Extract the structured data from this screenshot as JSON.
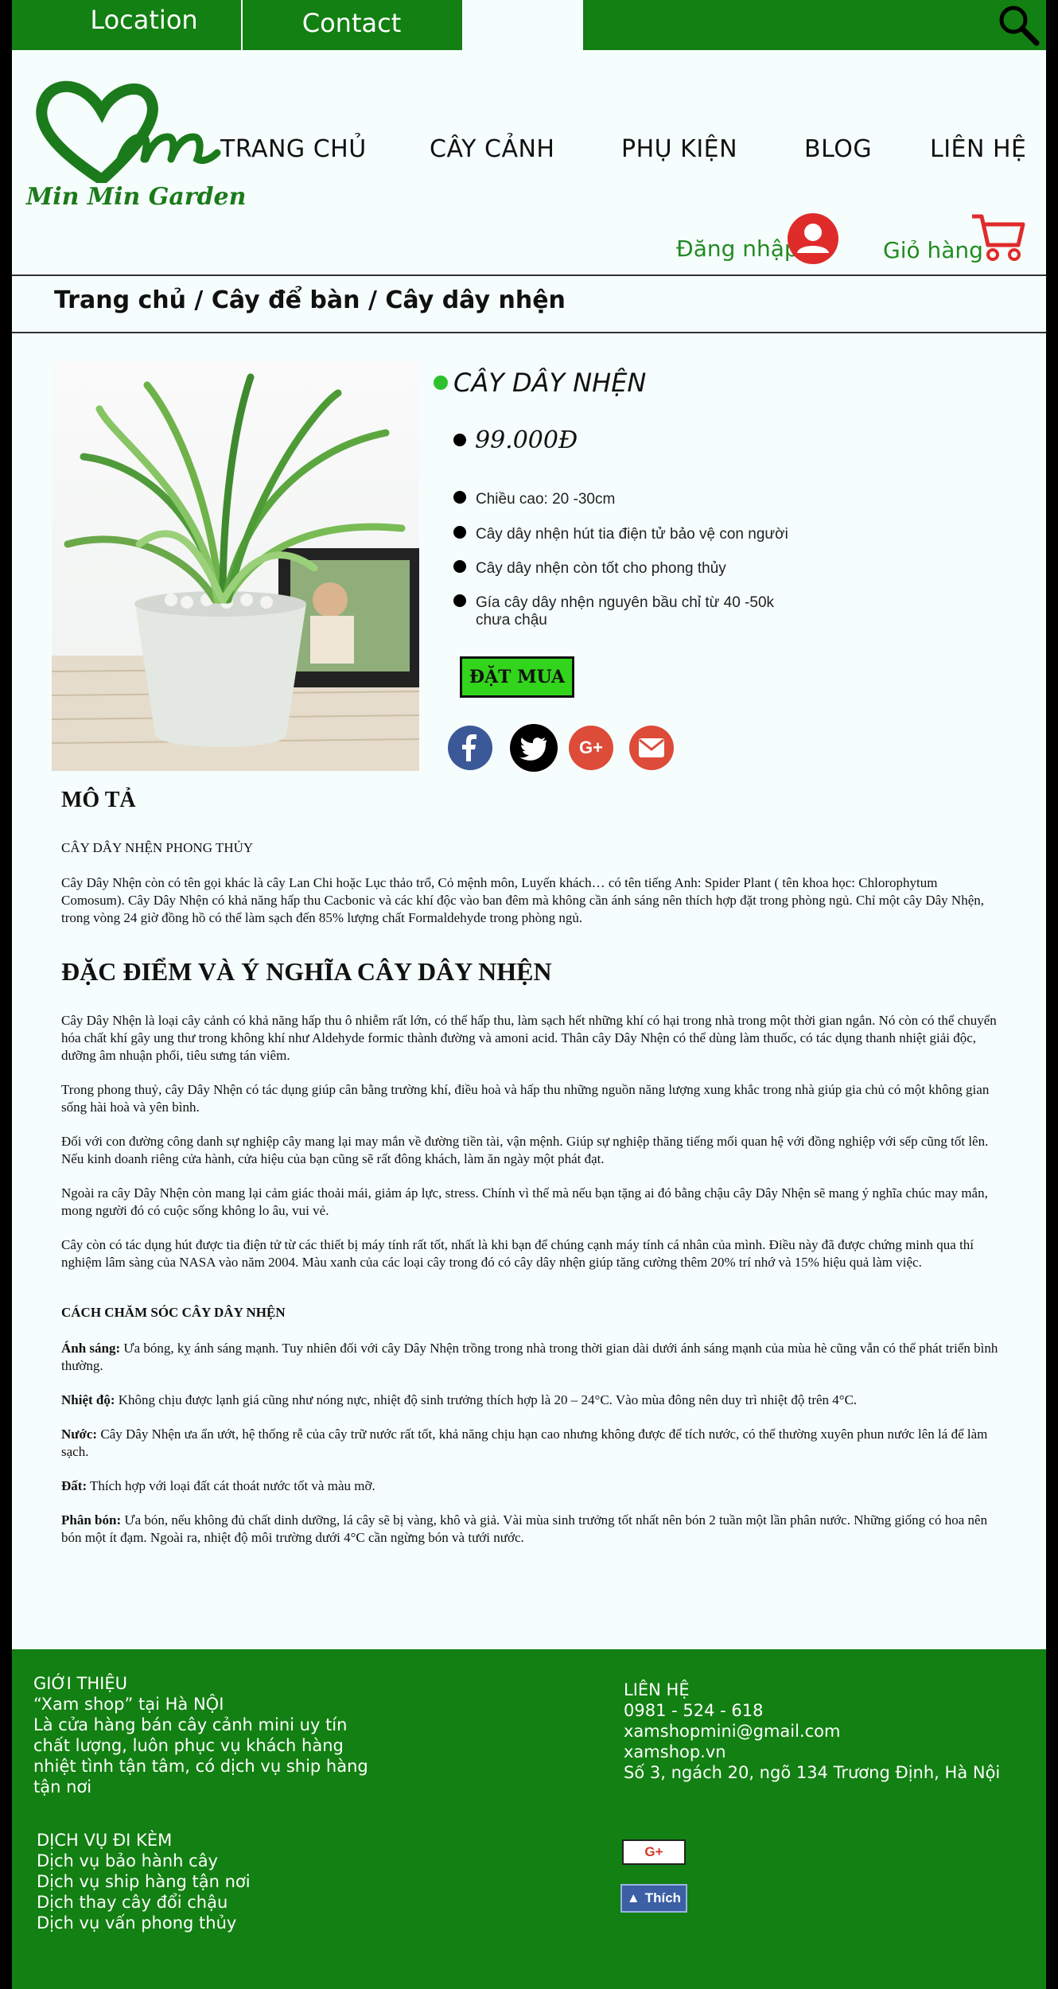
{
  "topbar": {
    "location_label": "Location",
    "contact_label": "Contact",
    "search_icon": "search-icon"
  },
  "logo": {
    "text": "Min Min Garden",
    "brand_color": "#1b7a1b"
  },
  "nav": {
    "items": [
      {
        "label": "TRANG CHỦ"
      },
      {
        "label": "CÂY CẢNH"
      },
      {
        "label": "PHỤ KIỆN"
      },
      {
        "label": "BLOG"
      },
      {
        "label": "LIÊN HỆ"
      }
    ],
    "login_label": "Đăng nhập",
    "cart_label": "Giỏ hàng"
  },
  "breadcrumb": "Trang chủ / Cây để bàn / Cây dây nhện",
  "product": {
    "name": "CÂY DÂY NHỆN",
    "price": "99.000Đ",
    "features": [
      "Chiều cao: 20 -30cm",
      "Cây dây nhện hút tia điện tử bảo vệ con người",
      "Cây dây nhện còn tốt cho phong thủy",
      "Gía cây  dây nhện nguyên bầu chỉ từ 40 -50k chưa chậu"
    ],
    "buy_label": "ĐẶT MUA",
    "share_icons": [
      "facebook-icon",
      "twitter-icon",
      "google-plus-icon",
      "email-icon"
    ]
  },
  "description": {
    "heading": "MÔ TẢ",
    "subtitle": "CÂY DÂY NHỆN PHONG THỦY",
    "intro": "Cây Dây Nhện còn có tên gọi khác là cây Lan Chi hoặc Lục thảo trổ, Cỏ mệnh môn, Luyến khách… có tên tiếng Anh: Spider Plant ( tên khoa học: Chlorophytum Comosum). Cây Dây Nhện có khả năng hấp thu Cacbonic và các khí độc vào ban đêm mà không cần ánh sáng nên thích hợp đặt trong phòng ngủ. Chỉ một cây Dây Nhện, trong vòng 24 giờ đồng hồ có thể làm sạch đến 85% lượng chất Formaldehyde trong phòng ngủ.",
    "section_heading": "ĐẶC ĐIỂM VÀ Ý NGHĨA CÂY DÂY NHỆN",
    "p1": "Cây Dây Nhện là loại cây cảnh có khả năng hấp thu ô nhiễm rất lớn, có thể hấp thu, làm sạch hết những khí có hại trong nhà trong một thời gian ngắn. Nó còn có thể chuyển hóa chất khí gây ung thư trong không khí như Aldehyde formic thành đường và amoni acid. Thân cây Dây Nhện có thể dùng làm thuốc, có tác dụng thanh nhiệt giải độc, dưỡng âm nhuận phổi, tiêu sưng tán viêm.",
    "p2": "Trong phong thuỷ, cây Dây Nhện có tác dụng giúp cân bằng trường khí, điều hoà và hấp thu những nguồn năng lượng xung khắc trong nhà giúp gia chủ có một không gian sống hài hoà và yên bình.",
    "p3": "Đối với con đường công danh sự nghiệp cây mang lại may mắn về đường tiền tài, vận mệnh. Giúp sự nghiệp thăng tiếng mối quan hệ với đồng nghiệp với sếp cũng tốt lên. Nếu kinh doanh riêng cửa hành, cửa hiệu của bạn cũng sẽ rất đông khách, làm ăn ngày một phát đạt.",
    "p4": "Ngoài ra cây Dây Nhện còn mang lại cảm giác thoải mái, giảm áp lực, stress. Chính vì thế mà nếu bạn tặng ai đó bằng chậu cây Dây Nhện sẽ mang ý nghĩa chúc may mắn, mong người đó có cuộc sống không lo âu, vui vẻ.",
    "p5": "Cây còn có tác dụng hút được tia điện tử từ các thiết bị máy tính rất tốt, nhất là khi bạn để chúng cạnh máy tính cá nhân của mình. Điều này đã được chứng minh qua thí nghiệm lâm sàng của NASA vào năm 2004. Màu xanh của các loại cây trong đó có cây dây nhện giúp tăng cường thêm 20% trí nhớ và 15% hiệu quả làm việc.",
    "care_heading": "CÁCH CHĂM SÓC CÂY DÂY NHỆN",
    "care": [
      {
        "label": "Ánh sáng:",
        "text": " Ưa bóng, kỵ ánh sáng mạnh. Tuy nhiên đối với cây Dây Nhện trồng trong nhà trong thời gian dài dưới ánh sáng mạnh của mùa hè cũng vẫn có thể phát triển bình thường."
      },
      {
        "label": "Nhiệt độ:",
        "text": " Không chịu được lạnh giá cũng như nóng nực, nhiệt độ sinh trưởng thích hợp là 20 – 24°C. Vào mùa đông nên duy trì nhiệt độ trên 4°C."
      },
      {
        "label": "Nước:",
        "text": " Cây Dây Nhện ưa ẩn ướt, hệ thống rễ của cây trữ nước rất tốt, khả năng chịu hạn cao nhưng không được để tích nước, có thể thường xuyên phun nước lên lá để làm sạch."
      },
      {
        "label": "Đất:",
        "text": " Thích hợp với loại đất cát thoát nước tốt và màu mỡ."
      },
      {
        "label": "Phân bón:",
        "text": " Ưa bón, nếu không đủ chất dinh dưỡng, lá cây sẽ bị vàng, khô và giả. Vài mùa sinh trưởng tốt nhất nên bón 2 tuần một lần phân nước. Những giống có hoa nên bón một ít đạm. Ngoài ra, nhiệt độ môi trường dưới 4°C cần ngừng bón và tưới nước."
      }
    ]
  },
  "footer": {
    "about_heading": "GIỚI THIỆU",
    "about_lines": [
      "“Xam shop” tại Hà NỘI",
      "Là cửa hàng bán cây cảnh mini uy tín",
      "chất lượng, luôn phục vụ khách hàng",
      "nhiệt tình tận tâm, có dịch vụ ship hàng",
      "tận nơi"
    ],
    "services_heading": "DỊCH VỤ ĐI KÈM",
    "services": [
      "Dịch vụ bảo hành cây",
      "Dịch vụ ship hàng tận nơi",
      "Dịch thay cây đổi chậu",
      "Dịch vụ vấn phong thủy"
    ],
    "contact_heading": "LIÊN HỆ",
    "contact_lines": [
      "0981 - 524 - 618",
      "xamshopmini@gmail.com",
      "xamshop.vn",
      "Số 3, ngách 20, ngõ 134 Trương Định, Hà Nội"
    ],
    "gplus_label": "G+",
    "like_label": "Thích"
  },
  "colors": {
    "primary_green": "#128012",
    "accent_red": "#e02b2b",
    "buy_green": "#33d41c"
  }
}
